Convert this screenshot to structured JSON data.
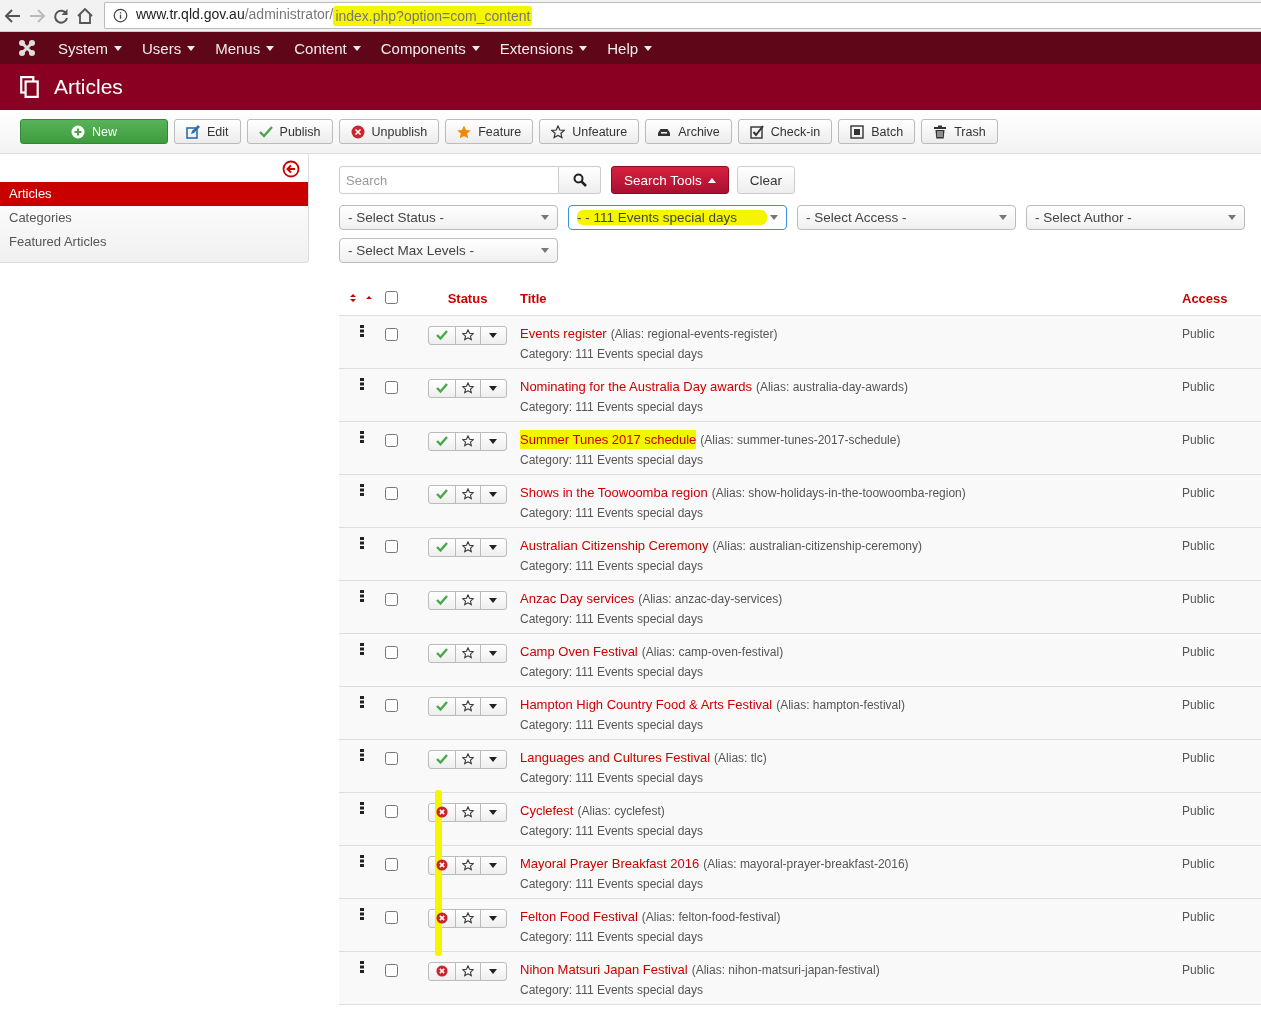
{
  "browser": {
    "url_host": "www.tr.qld.gov.au",
    "url_path": "/administrator/",
    "url_query": "index.php?option=com_content",
    "query_highlighted": true
  },
  "menu": [
    "System",
    "Users",
    "Menus",
    "Content",
    "Components",
    "Extensions",
    "Help"
  ],
  "page_title": "Articles",
  "toolbar": [
    {
      "label": "New",
      "kind": "new"
    },
    {
      "label": "Edit",
      "kind": "edit"
    },
    {
      "label": "Publish",
      "kind": "publish"
    },
    {
      "label": "Unpublish",
      "kind": "unpublish"
    },
    {
      "label": "Feature",
      "kind": "feature"
    },
    {
      "label": "Unfeature",
      "kind": "unfeature"
    },
    {
      "label": "Archive",
      "kind": "archive"
    },
    {
      "label": "Check-in",
      "kind": "checkin"
    },
    {
      "label": "Batch",
      "kind": "batch"
    },
    {
      "label": "Trash",
      "kind": "trash"
    }
  ],
  "sidebar": {
    "items": [
      {
        "label": "Articles",
        "selected": true
      },
      {
        "label": "Categories",
        "selected": false
      },
      {
        "label": "Featured Articles",
        "selected": false
      }
    ]
  },
  "search": {
    "placeholder": "Search",
    "tools_label": "Search Tools",
    "clear_label": "Clear"
  },
  "filters": [
    {
      "value": "- Select Status -",
      "highlighted": false
    },
    {
      "value": "- - 111 Events special days",
      "highlighted": true
    },
    {
      "value": "- Select Access -",
      "highlighted": false
    },
    {
      "value": "- Select Author -",
      "highlighted": false
    },
    {
      "value": "- Select Max Levels -",
      "highlighted": false
    }
  ],
  "table": {
    "columns": [
      "Status",
      "Title",
      "Access"
    ],
    "select_all_checked": false,
    "rows": [
      {
        "title": "Events register",
        "alias": "(Alias: regional-events-register)",
        "category": "Category: 111 Events special days",
        "access": "Public",
        "published": true,
        "checked": false,
        "featured": false,
        "highlighted": false,
        "marked": false
      },
      {
        "title": "Nominating for the Australia Day awards",
        "alias": "(Alias: australia-day-awards)",
        "category": "Category: 111 Events special days",
        "access": "Public",
        "published": true,
        "checked": false,
        "featured": false,
        "highlighted": false,
        "marked": false
      },
      {
        "title": "Summer Tunes 2017 schedule",
        "alias": "(Alias: summer-tunes-2017-schedule)",
        "category": "Category: 111 Events special days",
        "access": "Public",
        "published": true,
        "checked": false,
        "featured": false,
        "highlighted": true,
        "marked": false
      },
      {
        "title": "Shows in the Toowoomba region",
        "alias": "(Alias: show-holidays-in-the-toowoomba-region)",
        "category": "Category: 111 Events special days",
        "access": "Public",
        "published": true,
        "checked": false,
        "featured": false,
        "highlighted": false,
        "marked": false
      },
      {
        "title": "Australian Citizenship Ceremony",
        "alias": "(Alias: australian-citizenship-ceremony)",
        "category": "Category: 111 Events special days",
        "access": "Public",
        "published": true,
        "checked": false,
        "featured": false,
        "highlighted": false,
        "marked": false
      },
      {
        "title": "Anzac Day services",
        "alias": "(Alias: anzac-day-services)",
        "category": "Category: 111 Events special days",
        "access": "Public",
        "published": true,
        "checked": false,
        "featured": false,
        "highlighted": false,
        "marked": false
      },
      {
        "title": "Camp Oven Festival",
        "alias": "(Alias: camp-oven-festival)",
        "category": "Category: 111 Events special days",
        "access": "Public",
        "published": true,
        "checked": false,
        "featured": false,
        "highlighted": false,
        "marked": false
      },
      {
        "title": "Hampton High Country Food & Arts Festival",
        "alias": "(Alias: hampton-festival)",
        "category": "Category: 111 Events special days",
        "access": "Public",
        "published": true,
        "checked": false,
        "featured": false,
        "highlighted": false,
        "marked": false
      },
      {
        "title": "Languages and Cultures Festival",
        "alias": "(Alias: tlc)",
        "category": "Category: 111 Events special days",
        "access": "Public",
        "published": true,
        "checked": false,
        "featured": false,
        "highlighted": false,
        "marked": false
      },
      {
        "title": "Cyclefest",
        "alias": "(Alias: cyclefest)",
        "category": "Category: 111 Events special days",
        "access": "Public",
        "published": false,
        "checked": false,
        "featured": false,
        "highlighted": false,
        "marked": true
      },
      {
        "title": "Mayoral Prayer Breakfast 2016",
        "alias": "(Alias: mayoral-prayer-breakfast-2016)",
        "category": "Category: 111 Events special days",
        "access": "Public",
        "published": false,
        "checked": false,
        "featured": false,
        "highlighted": false,
        "marked": true
      },
      {
        "title": "Felton Food Festival",
        "alias": "(Alias: felton-food-festival)",
        "category": "Category: 111 Events special days",
        "access": "Public",
        "published": false,
        "checked": false,
        "featured": false,
        "highlighted": false,
        "marked": true
      },
      {
        "title": "Nihon Matsuri Japan Festival",
        "alias": "(Alias: nihon-matsuri-japan-festival)",
        "category": "Category: 111 Events special days",
        "access": "Public",
        "published": false,
        "checked": false,
        "featured": false,
        "highlighted": false,
        "marked": false
      }
    ]
  }
}
